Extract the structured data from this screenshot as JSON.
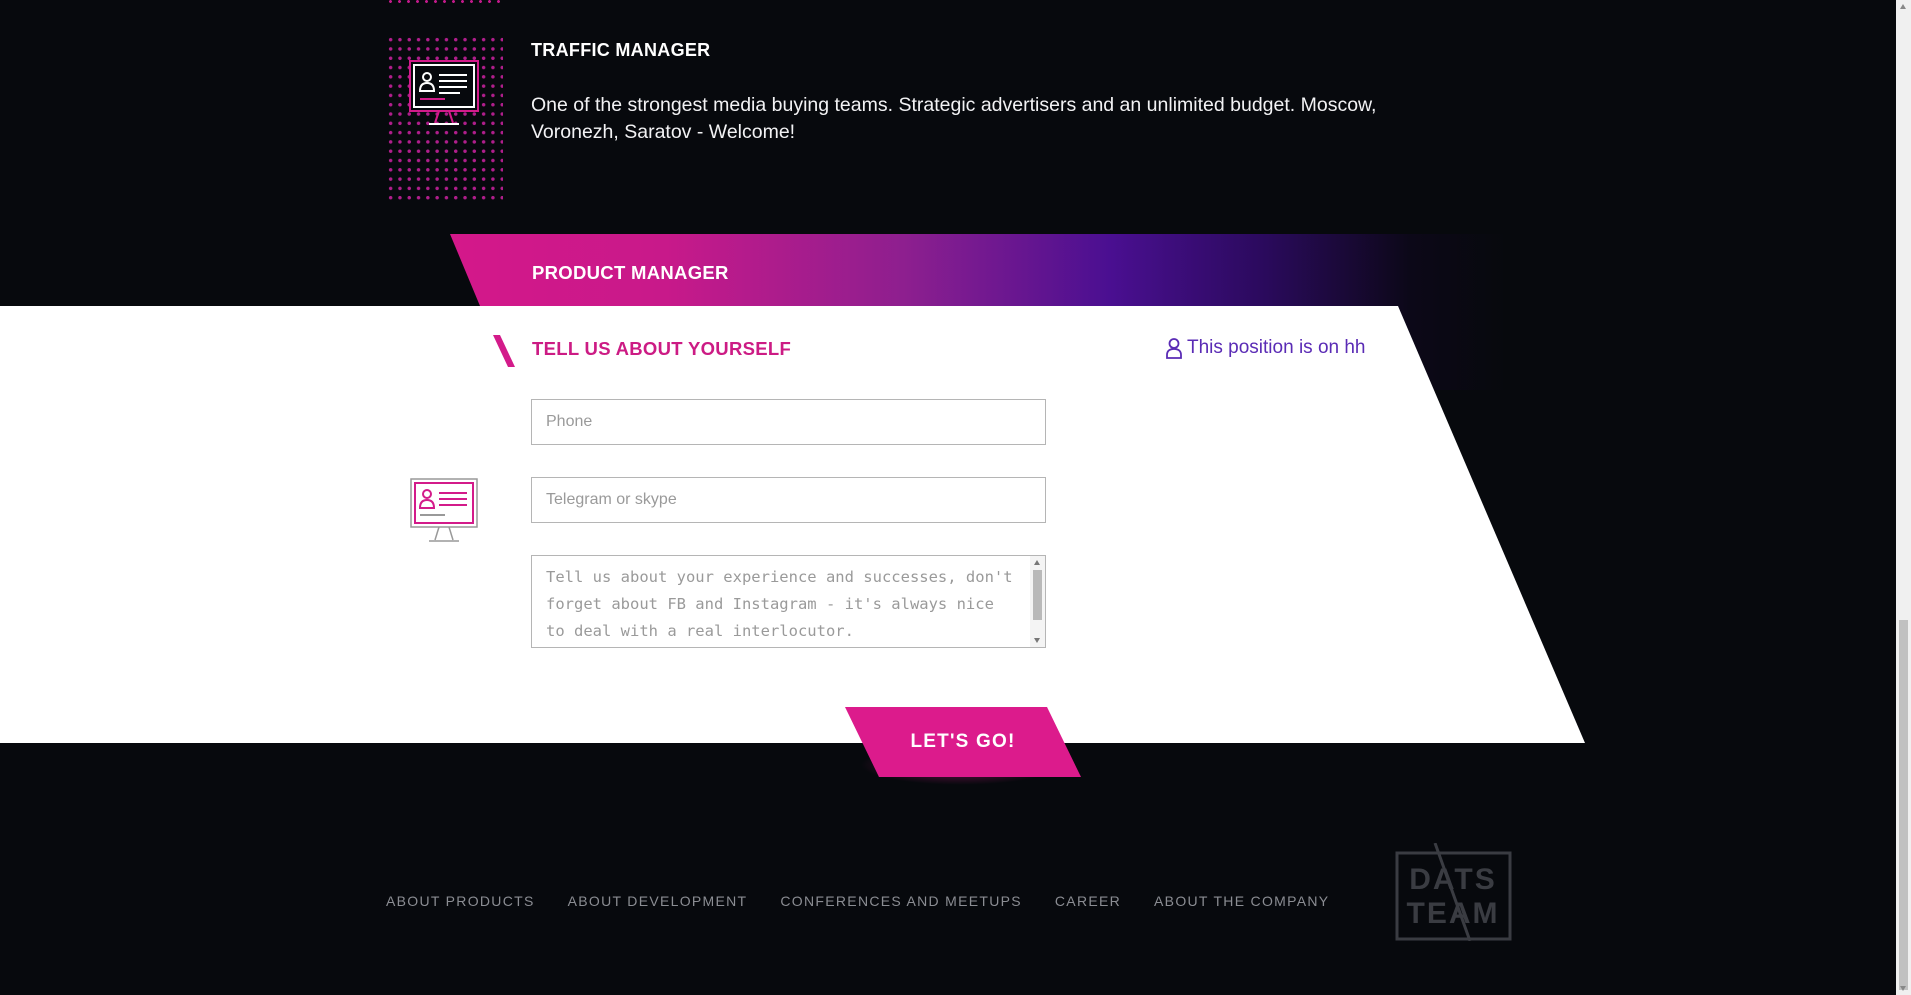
{
  "traffic_manager": {
    "title": "TRAFFIC MANAGER",
    "description": "One of the strongest media buying teams. Strategic advertisers and an unlimited budget. Moscow, Voronezh, Saratov - Welcome!",
    "icon": "computer-user-profile-icon"
  },
  "product_manager": {
    "title": "PRODUCT MANAGER"
  },
  "form": {
    "title": "TELL US ABOUT YOURSELF",
    "hh_link": "This position is on hh",
    "hh_icon": "user-icon",
    "icon": "computer-user-profile-icon",
    "phone_placeholder": "Phone",
    "phone_value": "",
    "telegram_placeholder": "Telegram or skype",
    "telegram_value": "",
    "about_placeholder": "Tell us about your experience and successes, don't forget about FB and Instagram - it's always nice to deal with a real interlocutor.",
    "about_value": "",
    "submit_label": "LET'S GO!"
  },
  "footer": {
    "nav": [
      {
        "label": "ABOUT PRODUCTS"
      },
      {
        "label": "ABOUT DEVELOPMENT"
      },
      {
        "label": "CONFERENCES AND MEETUPS"
      },
      {
        "label": "CAREER"
      },
      {
        "label": "ABOUT THE COMPANY"
      }
    ],
    "logo_line1": "DATS",
    "logo_line2": "TEAM"
  },
  "colors": {
    "accent": "#dc1b8c",
    "purple": "#5a2bb5",
    "background": "#07090d"
  }
}
